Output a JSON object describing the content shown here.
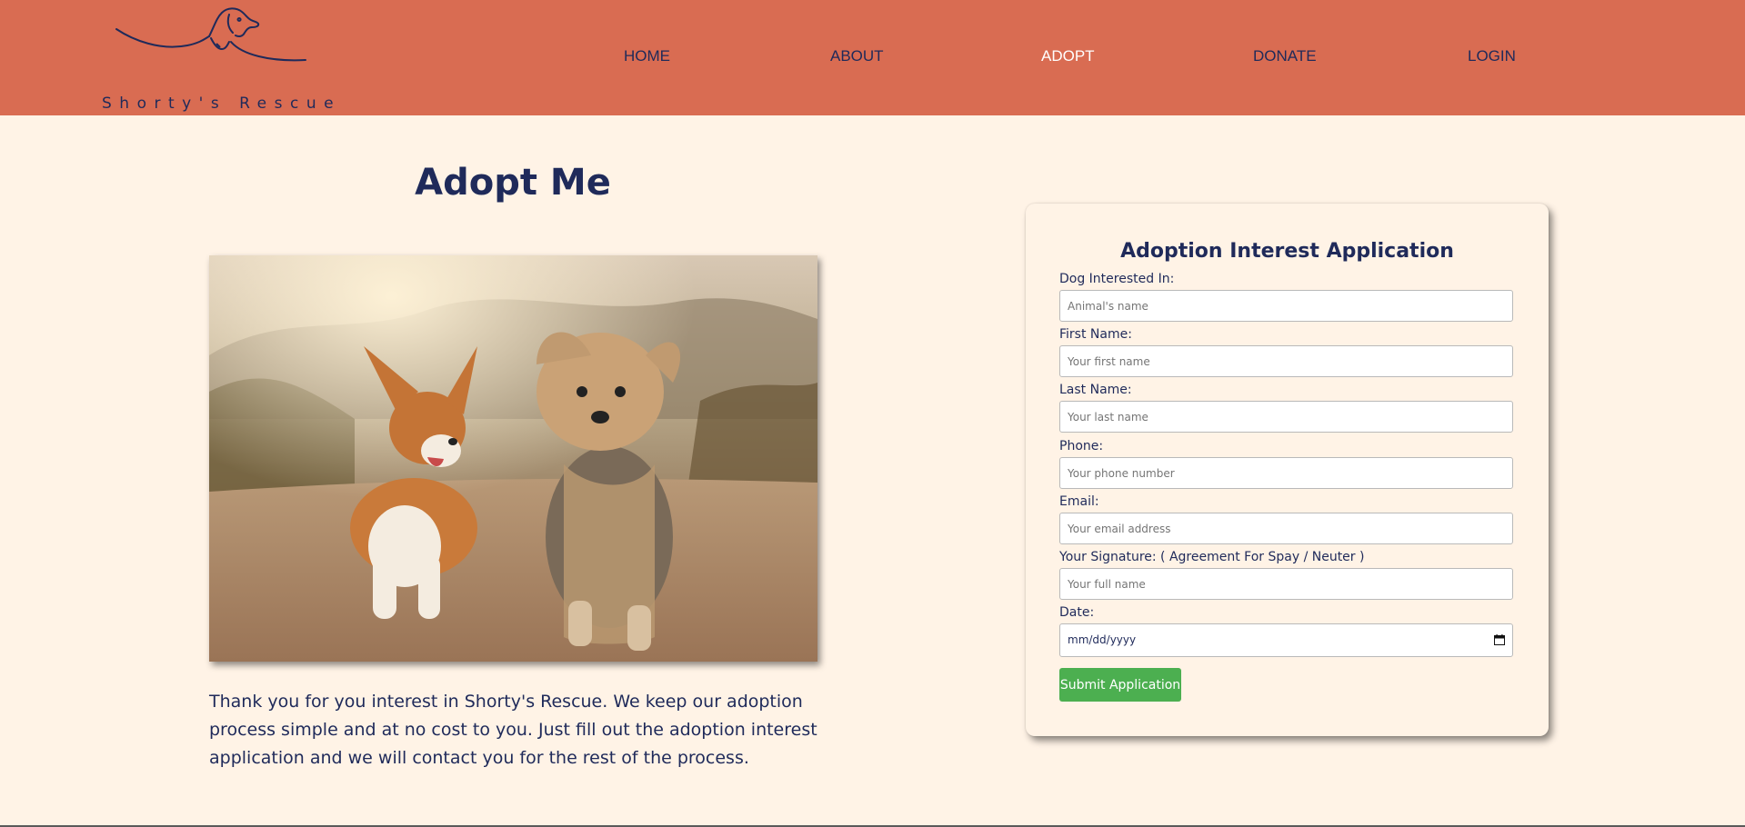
{
  "brand": {
    "name": "Shorty's Rescue",
    "logo_icon": "dog-line-drawing-icon"
  },
  "nav": [
    {
      "label": "HOME",
      "active": false
    },
    {
      "label": "ABOUT",
      "active": false
    },
    {
      "label": "ADOPT",
      "active": true
    },
    {
      "label": "DONATE",
      "active": false
    },
    {
      "label": "LOGIN",
      "active": false
    }
  ],
  "main": {
    "title": "Adopt Me",
    "intro": "Thank you for you interest in Shorty's Rescue. We keep our adoption process simple and at no cost to you. Just fill out the adoption interest application and we will contact you for the rest of the process."
  },
  "form": {
    "title": "Adoption Interest Application",
    "fields": [
      {
        "label": "Dog Interested In:",
        "placeholder": "Animal's name",
        "value": ""
      },
      {
        "label": "First Name:",
        "placeholder": "Your first name",
        "value": ""
      },
      {
        "label": "Last Name:",
        "placeholder": "Your last name",
        "value": ""
      },
      {
        "label": "Phone:",
        "placeholder": "Your phone number",
        "value": ""
      },
      {
        "label": "Email:",
        "placeholder": "Your email address",
        "value": ""
      },
      {
        "label": "Your Signature: ( Agreement For Spay / Neuter )",
        "placeholder": "Your full name",
        "value": ""
      }
    ],
    "date": {
      "label": "Date:",
      "placeholder": "mm/dd/yyyy",
      "icon": "calendar-icon"
    },
    "submit_label": "Submit Application"
  },
  "colors": {
    "header_bg": "#d96c52",
    "page_bg": "#fff3e6",
    "text_navy": "#1f2a5a",
    "nav_active": "#ffffff",
    "submit_green": "#4caf50"
  }
}
